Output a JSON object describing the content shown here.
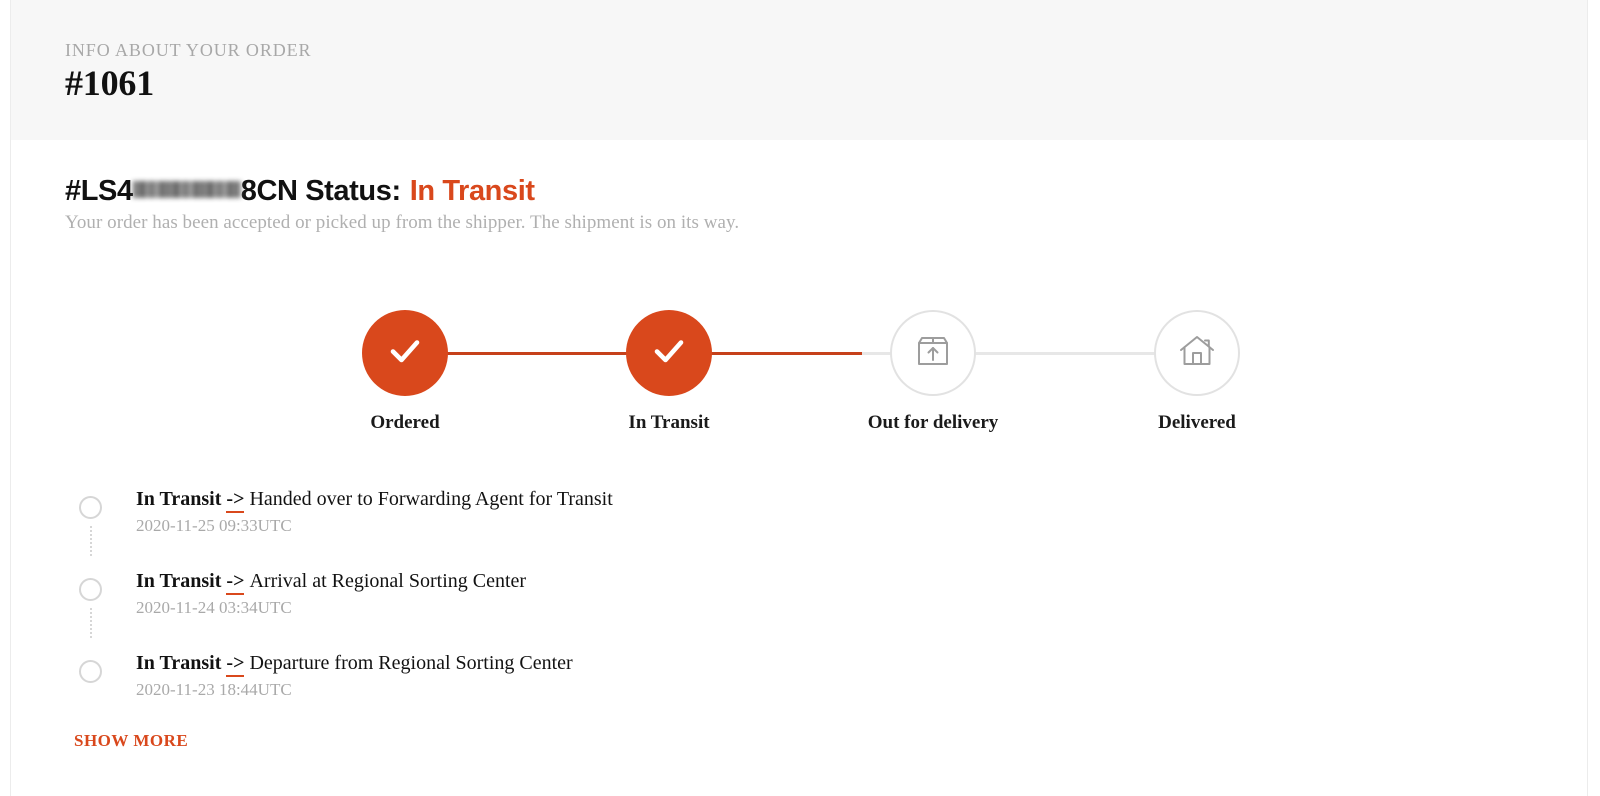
{
  "header": {
    "eyebrow": "INFO ABOUT YOUR ORDER",
    "order_number": "#1061",
    "background_color": "#f7f7f7"
  },
  "status": {
    "tracking_prefix": "#LS4",
    "tracking_redacted": "",
    "tracking_suffix": "8CN",
    "status_label": "Status:",
    "status_value": "In Transit",
    "status_color": "#d9481c",
    "description": "Your order has been accepted or picked up from the shipper. The shipment is on its way."
  },
  "stepper": {
    "accent_color": "#d9481c",
    "track_color": "#e7e7e7",
    "steps": [
      {
        "label": "Ordered",
        "state": "done",
        "icon": "check-icon"
      },
      {
        "label": "In Transit",
        "state": "done",
        "icon": "check-icon"
      },
      {
        "label": "Out for delivery",
        "state": "todo",
        "icon": "package-upload-icon"
      },
      {
        "label": "Delivered",
        "state": "todo",
        "icon": "home-icon"
      }
    ]
  },
  "timeline": {
    "events": [
      {
        "status": "In Transit",
        "arrow": "->",
        "description": "Handed over to Forwarding Agent for Transit",
        "timestamp": "2020-11-25 09:33UTC"
      },
      {
        "status": "In Transit",
        "arrow": "->",
        "description": "Arrival at Regional Sorting Center",
        "timestamp": "2020-11-24 03:34UTC"
      },
      {
        "status": "In Transit",
        "arrow": "->",
        "description": "Departure from Regional Sorting Center",
        "timestamp": "2020-11-23 18:44UTC"
      }
    ]
  },
  "actions": {
    "show_more_label": "SHOW MORE"
  }
}
